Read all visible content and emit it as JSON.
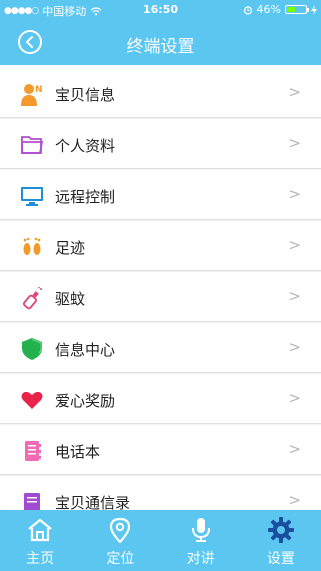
{
  "status_bar": {
    "carrier": "中国移动",
    "time": "16:50",
    "battery": "46%",
    "battery_level": 0.46
  },
  "header": {
    "title": "终端设置"
  },
  "menu": {
    "items": [
      {
        "label": "宝贝信息",
        "icon": "baby-info-icon"
      },
      {
        "label": "个人资料",
        "icon": "folder-icon"
      },
      {
        "label": "远程控制",
        "icon": "monitor-icon"
      },
      {
        "label": "足迹",
        "icon": "footprints-icon"
      },
      {
        "label": "驱蚊",
        "icon": "mosquito-repellent-icon"
      },
      {
        "label": "信息中心",
        "icon": "shield-icon"
      },
      {
        "label": "爱心奖励",
        "icon": "heart-icon"
      },
      {
        "label": "电话本",
        "icon": "phonebook-icon"
      },
      {
        "label": "宝贝通信录",
        "icon": "contacts-icon"
      }
    ],
    "chevron": ">"
  },
  "tabbar": {
    "tabs": [
      {
        "label": "主页",
        "icon": "home-icon"
      },
      {
        "label": "定位",
        "icon": "location-pin-icon"
      },
      {
        "label": "对讲",
        "icon": "microphone-icon"
      },
      {
        "label": "设置",
        "icon": "gear-icon",
        "active": true
      }
    ]
  },
  "colors": {
    "primary": "#5bc6f0",
    "active_tab_icon": "#1a4fa0",
    "chevron": "#b7b7b7"
  }
}
